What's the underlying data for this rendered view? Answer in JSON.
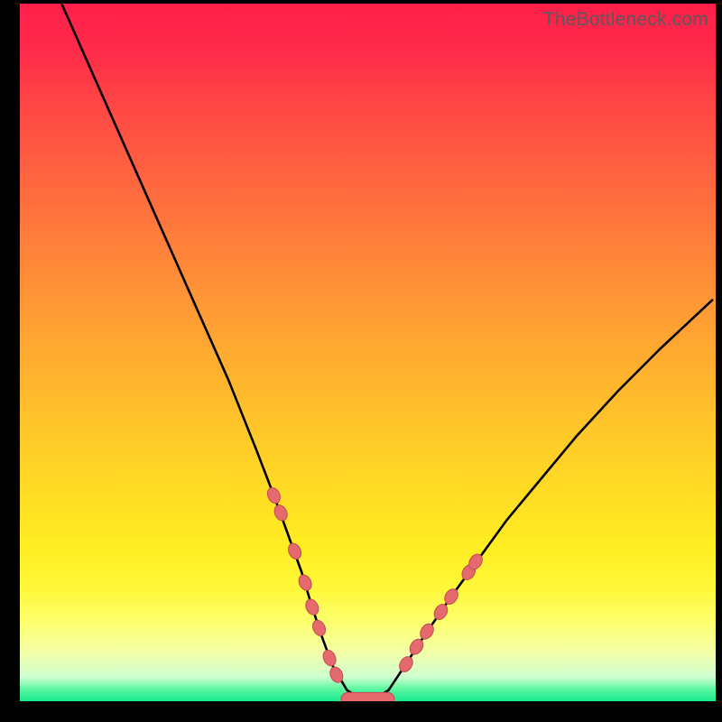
{
  "attribution": "TheBottleneck.com",
  "colors": {
    "frame_bg": "#000000",
    "curve_stroke": "#000000",
    "marker_fill": "#e46a6e",
    "marker_stroke": "#c34a52",
    "gradient_top": "#ff1f4a",
    "gradient_bottom": "#18e78d"
  },
  "chart_data": {
    "type": "line",
    "title": "",
    "xlabel": "",
    "ylabel": "",
    "xlim": [
      0,
      100
    ],
    "ylim": [
      0,
      100
    ],
    "grid": false,
    "legend": false,
    "series": [
      {
        "name": "bottleneck-curve",
        "x": [
          6.0,
          10,
          14,
          18,
          22,
          26,
          30,
          34,
          36.5,
          38.5,
          40.5,
          42,
          43.5,
          45,
          47,
          49,
          51,
          53,
          55,
          58,
          62,
          66,
          70,
          75,
          80,
          86,
          92,
          99.5
        ],
        "y": [
          100,
          91,
          82,
          73,
          64,
          55,
          46,
          36,
          29.5,
          24,
          18.5,
          13.5,
          9,
          5,
          1.6,
          0.3,
          0.3,
          1.6,
          4.6,
          9.2,
          15,
          20.5,
          26,
          32,
          38,
          44.5,
          50.5,
          57.5
        ]
      }
    ],
    "markers": [
      {
        "x": 36.5,
        "y": 29.5
      },
      {
        "x": 37.5,
        "y": 27.0
      },
      {
        "x": 39.5,
        "y": 21.5
      },
      {
        "x": 41.0,
        "y": 17.0
      },
      {
        "x": 42.0,
        "y": 13.5
      },
      {
        "x": 43.0,
        "y": 10.5
      },
      {
        "x": 44.5,
        "y": 6.2
      },
      {
        "x": 45.5,
        "y": 3.8
      },
      {
        "x": 55.5,
        "y": 5.3
      },
      {
        "x": 57.0,
        "y": 7.8
      },
      {
        "x": 58.5,
        "y": 10.0
      },
      {
        "x": 60.5,
        "y": 12.8
      },
      {
        "x": 62.0,
        "y": 15.0
      },
      {
        "x": 64.5,
        "y": 18.5
      },
      {
        "x": 65.5,
        "y": 20.0
      }
    ],
    "flat_segment": {
      "x_start": 46.2,
      "x_end": 53.8,
      "y": 0.35,
      "thickness_y_units": 1.8
    }
  }
}
